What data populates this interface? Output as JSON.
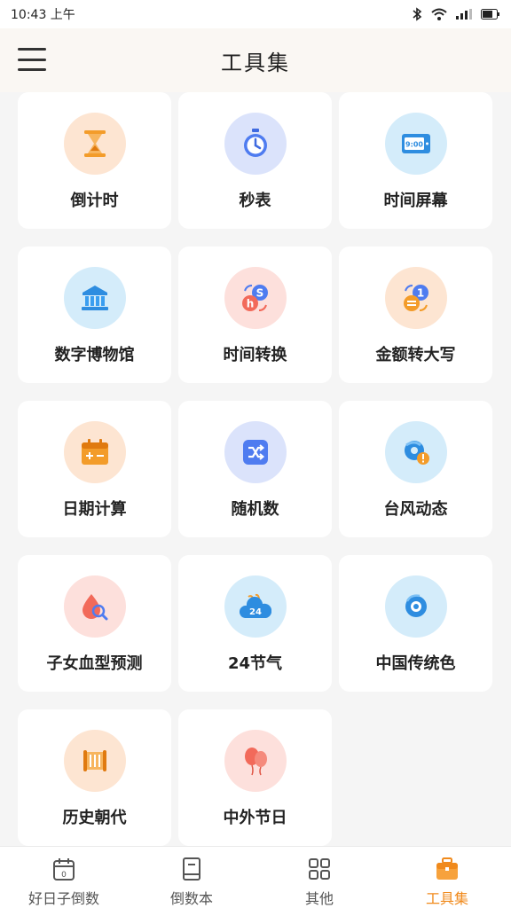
{
  "status_bar": {
    "time": "10:43 上午"
  },
  "header": {
    "title": "工具集"
  },
  "tools": [
    {
      "label": "倒计时",
      "icon": "hourglass-icon",
      "bg": "#fde5d2"
    },
    {
      "label": "秒表",
      "icon": "stopwatch-icon",
      "bg": "#dbe3fb"
    },
    {
      "label": "时间屏幕",
      "icon": "clock-screen-icon",
      "bg": "#d4ecfa"
    },
    {
      "label": "数字博物馆",
      "icon": "museum-icon",
      "bg": "#d4ecfa"
    },
    {
      "label": "时间转换",
      "icon": "time-convert-icon",
      "bg": "#fde0dc"
    },
    {
      "label": "金额转大写",
      "icon": "currency-convert-icon",
      "bg": "#fde5d2"
    },
    {
      "label": "日期计算",
      "icon": "calendar-calc-icon",
      "bg": "#fde5d2"
    },
    {
      "label": "随机数",
      "icon": "shuffle-icon",
      "bg": "#dbe3fb"
    },
    {
      "label": "台风动态",
      "icon": "typhoon-icon",
      "bg": "#d4ecfa"
    },
    {
      "label": "子女血型预测",
      "icon": "blood-drop-icon",
      "bg": "#fde0dc"
    },
    {
      "label": "24节气",
      "icon": "solar-terms-icon",
      "bg": "#d4ecfa"
    },
    {
      "label": "中国传统色",
      "icon": "palette-icon",
      "bg": "#d4ecfa"
    },
    {
      "label": "历史朝代",
      "icon": "scroll-icon",
      "bg": "#fde5d2"
    },
    {
      "label": "中外节日",
      "icon": "balloons-icon",
      "bg": "#fde0dc"
    }
  ],
  "tab_bar": {
    "tabs": [
      {
        "label": "好日子倒数",
        "icon": "calendar-icon",
        "active": false
      },
      {
        "label": "倒数本",
        "icon": "notebook-icon",
        "active": false
      },
      {
        "label": "其他",
        "icon": "grid-icon",
        "active": false
      },
      {
        "label": "工具集",
        "icon": "toolbox-icon",
        "active": true
      }
    ]
  },
  "colors": {
    "accent": "#f08a1c",
    "header_bg": "#faf7f3",
    "page_bg": "#f5f5f5"
  }
}
